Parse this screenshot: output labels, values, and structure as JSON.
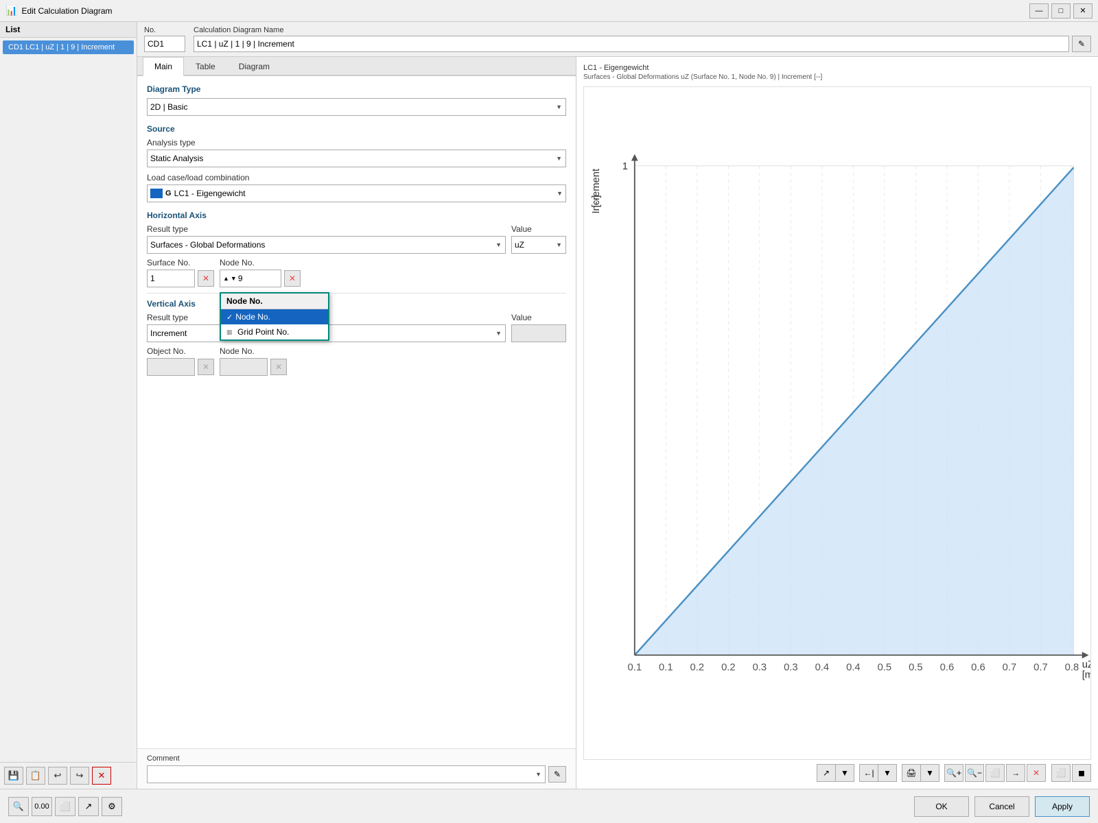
{
  "titleBar": {
    "title": "Edit Calculation Diagram",
    "icon": "📊",
    "minimizeLabel": "—",
    "maximizeLabel": "□",
    "closeLabel": "✕"
  },
  "leftPanel": {
    "header": "List",
    "items": [
      {
        "label": "CD1  LC1 | uZ | 1 | 9 | Increment"
      }
    ],
    "tools": [
      "💾",
      "📋",
      "↩",
      "↪",
      "✕"
    ]
  },
  "topFields": {
    "noLabel": "No.",
    "noValue": "CD1",
    "nameLabel": "Calculation Diagram Name",
    "nameValue": "LC1 | uZ | 1 | 9 | Increment",
    "editBtnLabel": "✎"
  },
  "tabs": [
    {
      "label": "Main",
      "active": true
    },
    {
      "label": "Table",
      "active": false
    },
    {
      "label": "Diagram",
      "active": false
    }
  ],
  "form": {
    "diagramTypeSection": "Diagram Type",
    "diagramTypeValue": "2D | Basic",
    "sourceSection": "Source",
    "analysisTypeLabel": "Analysis type",
    "analysisTypeValue": "Static Analysis",
    "loadCaseLabel": "Load case/load combination",
    "loadCaseColor": "#1565c0",
    "loadCaseG": "G",
    "loadCaseValue": "LC1 - Eigengewicht",
    "horizontalAxisSection": "Horizontal Axis",
    "resultTypeLabel": "Result type",
    "resultTypeValue": "Surfaces - Global Deformations",
    "valueLabel": "Value",
    "valueValue": "uZ",
    "surfaceNoLabel": "Surface No.",
    "surfaceNoValue": "1",
    "nodeNoLabel": "Node No.",
    "nodeNoValue": "9",
    "dropdownOptions": [
      {
        "label": "Node No.",
        "selected": true
      },
      {
        "label": "Grid Point No.",
        "selected": false
      }
    ],
    "verticalAxisSection": "Vertical Axis",
    "vertAxisResultTypeLabel": "Result type",
    "vertAxisResultTypeValue": "Increment",
    "vertAxisValueLabel": "Value",
    "vertAxisValueValue": "",
    "objectNoLabel": "Object No.",
    "vertNodeNoLabel": "Node No.",
    "commentSection": "Comment",
    "commentValue": "",
    "commentPlaceholder": ""
  },
  "chart": {
    "title": "LC1 - Eigengewicht",
    "subtitle": "Surfaces - Global Deformations uZ (Surface No. 1, Node No. 9) | Increment [--]",
    "yAxisLabel": "Increment",
    "yAxisUnit": "[--]",
    "xAxisLabel": "uZ",
    "xAxisUnit": "[mm]",
    "yMax": "1",
    "xValues": [
      "0.1",
      "0.1",
      "0.2",
      "0.2",
      "0.3",
      "0.3",
      "0.4",
      "0.4",
      "0.5",
      "0.5",
      "0.6",
      "0.6",
      "0.7",
      "0.7",
      "0.8"
    ],
    "tools": [
      {
        "icon": "↗",
        "label": "fit",
        "group": "fit"
      },
      {
        "icon": "←",
        "label": "fit-left",
        "group": "fit"
      },
      {
        "icon": "🖨",
        "label": "print",
        "group": "print"
      },
      {
        "icon": "🔍+",
        "label": "zoom-in"
      },
      {
        "icon": "🔍-",
        "label": "zoom-out"
      },
      {
        "icon": "🔍□",
        "label": "zoom-box"
      },
      {
        "icon": "🔍→",
        "label": "zoom-right"
      },
      {
        "icon": "✕",
        "label": "reset-zoom"
      },
      {
        "icon": "⬜",
        "label": "view1"
      },
      {
        "icon": "⬛",
        "label": "view2"
      }
    ]
  },
  "bottomBar": {
    "tools": [
      "🔍",
      "0.00",
      "⬜",
      "↗",
      "⚙"
    ],
    "okLabel": "OK",
    "cancelLabel": "Cancel",
    "applyLabel": "Apply"
  }
}
